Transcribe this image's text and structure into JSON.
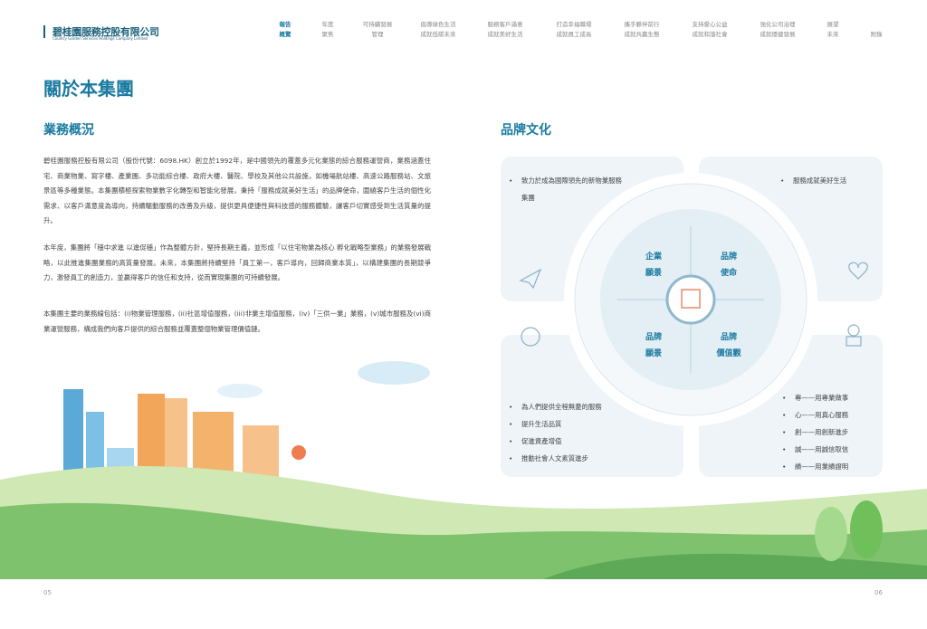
{
  "header": {
    "company_cn": "碧桂園服務控股有限公司",
    "company_en": "Country Garden Services Holdings Company Limited",
    "nav": [
      [
        "報告",
        "概覽"
      ],
      [
        "年度",
        "聚焦"
      ],
      [
        "可持續發展",
        "管理"
      ],
      [
        "倡導綠色生活",
        "成就低碳未來"
      ],
      [
        "服務客戶滿意",
        "成就美好生活"
      ],
      [
        "打造幸福職場",
        "成就員工成長"
      ],
      [
        "攜手夥伴前行",
        "成就共贏生態"
      ],
      [
        "支持愛心公益",
        "成就和諧社會"
      ],
      [
        "強化公司治理",
        "成就穩健發展"
      ],
      [
        "展望",
        "未來"
      ],
      [
        "",
        "附錄"
      ]
    ]
  },
  "page_title": "關於本集團",
  "business": {
    "title": "業務概況",
    "paragraphs": [
      "碧桂園服務控股有限公司（股份代號：6098.HK）創立於1992年，是中國領先的覆蓋多元化業態的綜合服務運營商，業務涵蓋住宅、商業物業、寫字樓、產業園、多功能綜合樓、政府大樓、醫院、學校及其他公共設施，如機場航站樓、高速公路服務站、文旅景區等多種業態。本集團積極探索物業數字化轉型和智能化發展，秉持「服務成就美好生活」的品牌使命，圍繞客戶生活的個性化需求、以客戶滿意度為導向，持續驅動服務的改善及升級，提供更具便捷性與科技感的服務體驗，讓客戶切實感受到生活質量的提升。",
      "本年度，集團將「穩中求進 以進促穩」作為整體方針，堅持長期主義，並形成「以住宅物業為核心 孵化戰略型業務」的業務發展戰略，以此推進集團業務的高質量發展。未來，本集團將持續堅持「員工第一，客戶導向，回歸商業本質」，以構建集團的長期競爭力，激發員工的創造力，並贏得客戶的信任和支持，從而實現集團的可持續發展。",
      "本集團主要的業務線包括：(i)物業管理服務，(ii)社區增值服務，(iii)非業主增值服務，(iv)「三供一業」業務，(v)城市服務及(vi)商業運營服務，構成我們向客戶提供的綜合服務並覆蓋整個物業管理價值鏈。"
    ]
  },
  "brand": {
    "title": "品牌文化",
    "quadrants": [
      [
        "企業",
        "願景"
      ],
      [
        "品牌",
        "使命"
      ],
      [
        "品牌",
        "願景"
      ],
      [
        "品牌",
        "價值觀"
      ]
    ],
    "vision": [
      "致力於成為國際領先的新物業服務集團"
    ],
    "mission": [
      "服務成就美好生活"
    ],
    "brand_vision": [
      "為人們提供全程無憂的服務",
      "提升生活品質",
      "促進資產增值",
      "推動社會人文素質進步"
    ],
    "values": [
      "專——用專業做事",
      "心——用真心服務",
      "創——用創新進步",
      "誠——用誠信取信",
      "績——用業績證明"
    ]
  },
  "footer": {
    "left_page": "05",
    "right_page": "06"
  }
}
